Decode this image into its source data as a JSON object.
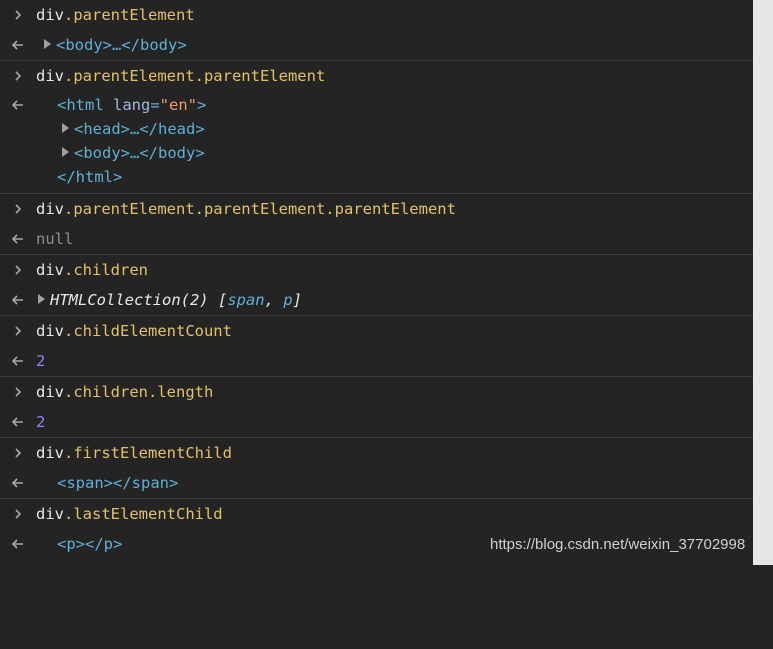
{
  "entries": [
    {
      "input": {
        "obj": "div",
        "path": ".parentElement"
      },
      "output": {
        "collapsed": "<body>…</body>"
      }
    },
    {
      "input": {
        "obj": "div",
        "path": ".parentElement.parentElement"
      },
      "output": {
        "open_tag_start": "<html ",
        "attr_name": "lang",
        "attr_eq": "=",
        "attr_value": "\"en\"",
        "open_tag_end": ">",
        "children": [
          "<head>…</head>",
          "<body>…</body>"
        ],
        "close_tag": "</html>"
      }
    },
    {
      "input": {
        "obj": "div",
        "path": ".parentElement.parentElement.parentElement"
      },
      "output": {
        "value": "null"
      }
    },
    {
      "input": {
        "obj": "div",
        "path": ".children"
      },
      "output": {
        "collection": "HTMLCollection(2) [",
        "items": [
          "span",
          "p"
        ],
        "sep": ", ",
        "end": "]"
      }
    },
    {
      "input": {
        "obj": "div",
        "path": ".childElementCount"
      },
      "output": {
        "value": "2"
      }
    },
    {
      "input": {
        "obj": "div",
        "path": ".children.length"
      },
      "output": {
        "value": "2"
      }
    },
    {
      "input": {
        "obj": "div",
        "path": ".firstElementChild"
      },
      "output": {
        "element": "<span></span>"
      }
    },
    {
      "input": {
        "obj": "div",
        "path": ".lastElementChild"
      },
      "output": {
        "element": "<p></p>"
      }
    }
  ],
  "watermark": "https://blog.csdn.net/weixin_37702998",
  "colors": {
    "background": "#242424",
    "property": "#e3c165",
    "tag": "#5db0d7",
    "string": "#f29766",
    "number": "#9980ff",
    "null": "#8e8e8e"
  }
}
